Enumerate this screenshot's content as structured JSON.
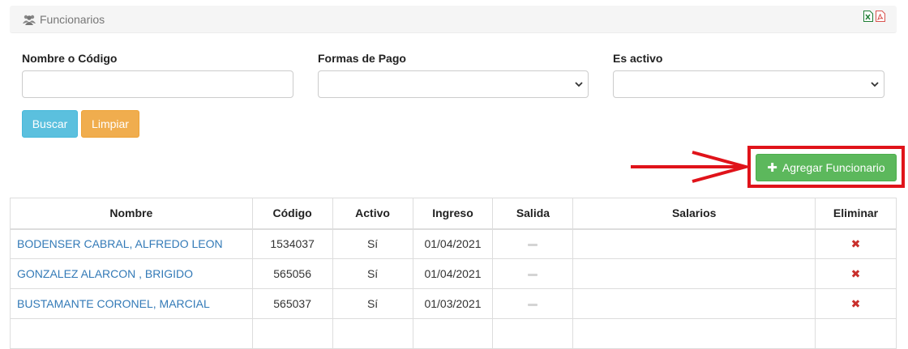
{
  "header": {
    "title": "Funcionarios",
    "excel_icon": "file-excel-icon",
    "pdf_icon": "file-pdf-icon",
    "excel_color": "#1e7e34",
    "pdf_color": "#d9534f"
  },
  "filters": {
    "nombre_label": "Nombre o Código",
    "nombre_value": "",
    "formas_label": "Formas de Pago",
    "formas_value": "",
    "activo_label": "Es activo",
    "activo_value": ""
  },
  "actions": {
    "buscar": "Buscar",
    "limpiar": "Limpiar",
    "agregar": "Agregar Funcionario"
  },
  "table": {
    "columns": [
      "Nombre",
      "Código",
      "Activo",
      "Ingreso",
      "Salida",
      "Salarios",
      "Eliminar"
    ],
    "rows": [
      {
        "nombre": "BODENSER CABRAL, ALFREDO LEON",
        "codigo": "1534037",
        "activo": "Sí",
        "ingreso": "01/04/2021"
      },
      {
        "nombre": "GONZALEZ ALARCON , BRIGIDO",
        "codigo": "565056",
        "activo": "Sí",
        "ingreso": "01/04/2021"
      },
      {
        "nombre": "BUSTAMANTE CORONEL, MARCIAL",
        "codigo": "565037",
        "activo": "Sí",
        "ingreso": "01/03/2021"
      }
    ]
  },
  "colors": {
    "info": "#5bc0de",
    "warning": "#f0ad4e",
    "success": "#5cb85c",
    "link": "#337ab7",
    "danger": "#c9302c",
    "annotation": "#e0131a"
  }
}
